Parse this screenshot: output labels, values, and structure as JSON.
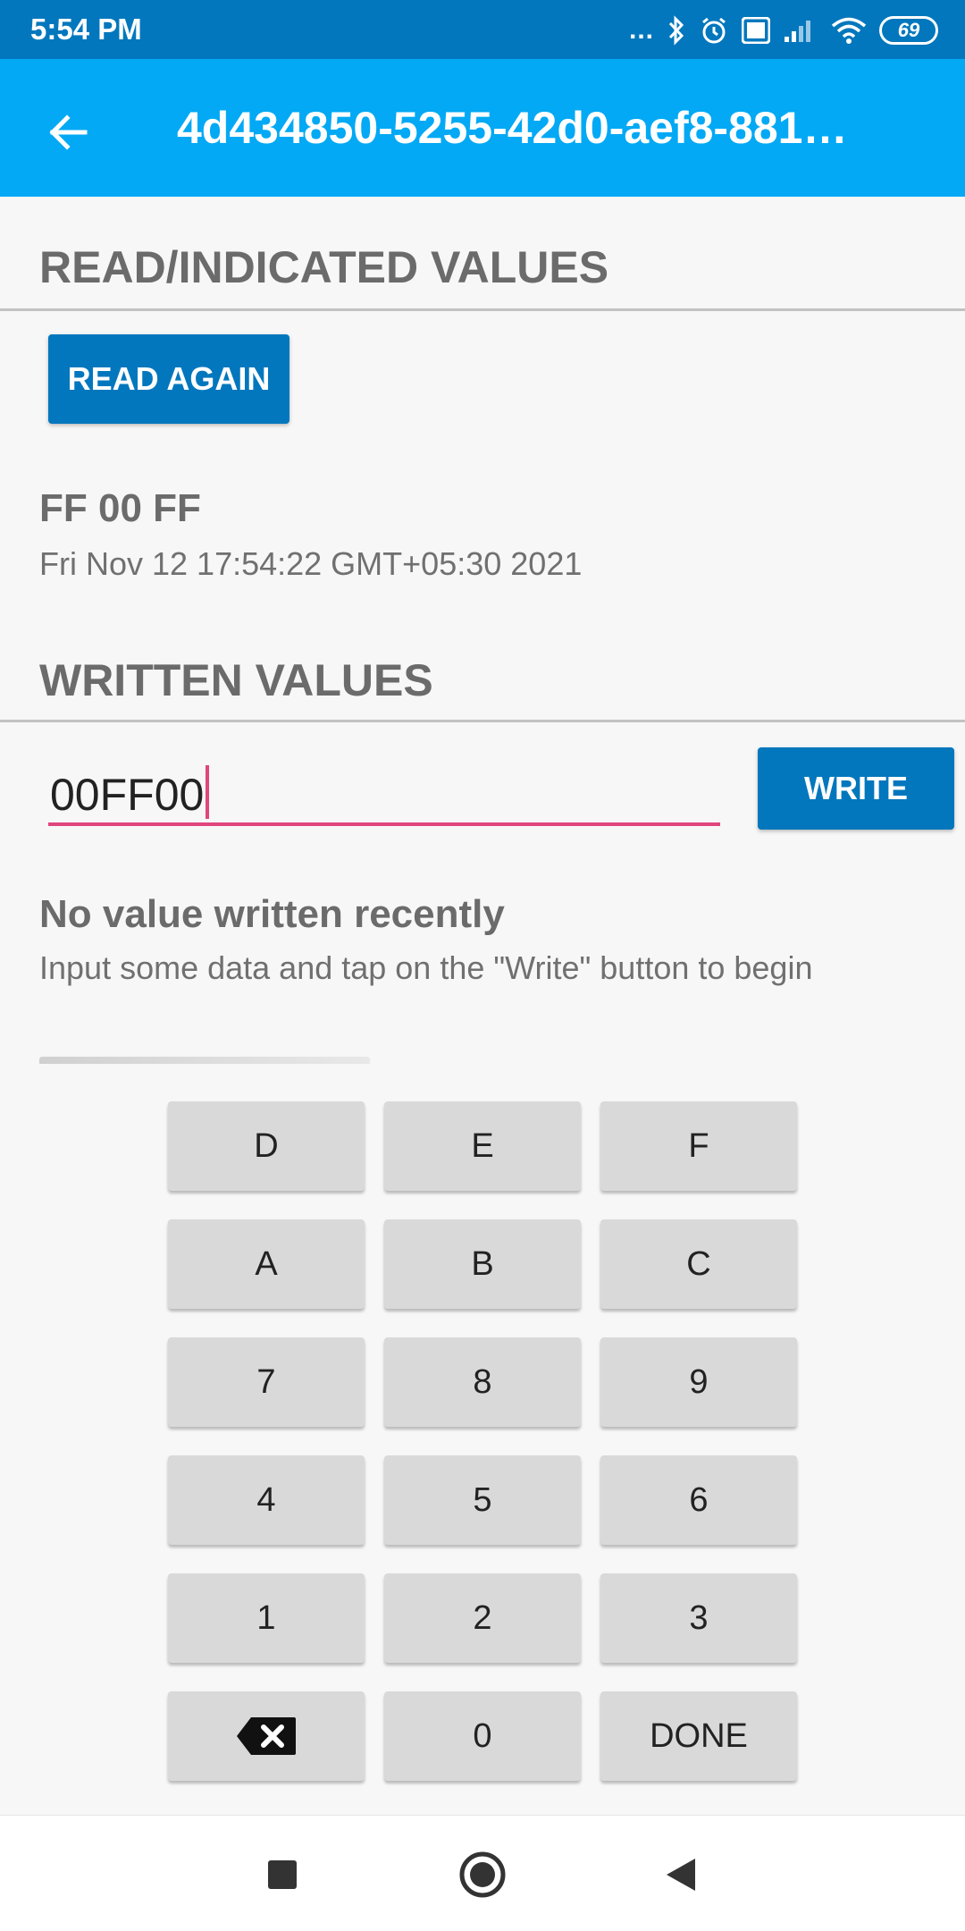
{
  "status_bar": {
    "time": "5:54 PM",
    "dots": "...",
    "battery": "69",
    "icons": [
      "bluetooth-icon",
      "alarm-icon",
      "volte-icon",
      "signal-icon",
      "wifi-icon",
      "battery-icon"
    ]
  },
  "app_bar": {
    "back_icon": "arrow-left-icon",
    "title": "4d434850-5255-42d0-aef8-881…"
  },
  "read_section": {
    "title": "READ/INDICATED VALUES",
    "read_again_label": "READ AGAIN",
    "value": "FF 00 FF",
    "timestamp": "Fri Nov 12 17:54:22 GMT+05:30 2021"
  },
  "write_section": {
    "title": "WRITTEN VALUES",
    "input_value": "00FF00",
    "write_label": "WRITE",
    "status_title": "No value written recently",
    "status_hint": "Input some data and tap on the \"Write\" button to begin"
  },
  "keyboard": {
    "rows": [
      [
        "D",
        "E",
        "F"
      ],
      [
        "A",
        "B",
        "C"
      ],
      [
        "7",
        "8",
        "9"
      ],
      [
        "4",
        "5",
        "6"
      ],
      [
        "1",
        "2",
        "3"
      ]
    ],
    "zero": "0",
    "done": "DONE",
    "backspace_icon": "backspace-icon"
  },
  "nav_bar": {
    "icons": [
      "recents-square-icon",
      "home-circle-icon",
      "back-triangle-icon"
    ]
  },
  "colors": {
    "status_bar": "#0277bd",
    "app_bar": "#03a9f4",
    "button": "#0277bd",
    "input_underline": "#e0457b"
  }
}
